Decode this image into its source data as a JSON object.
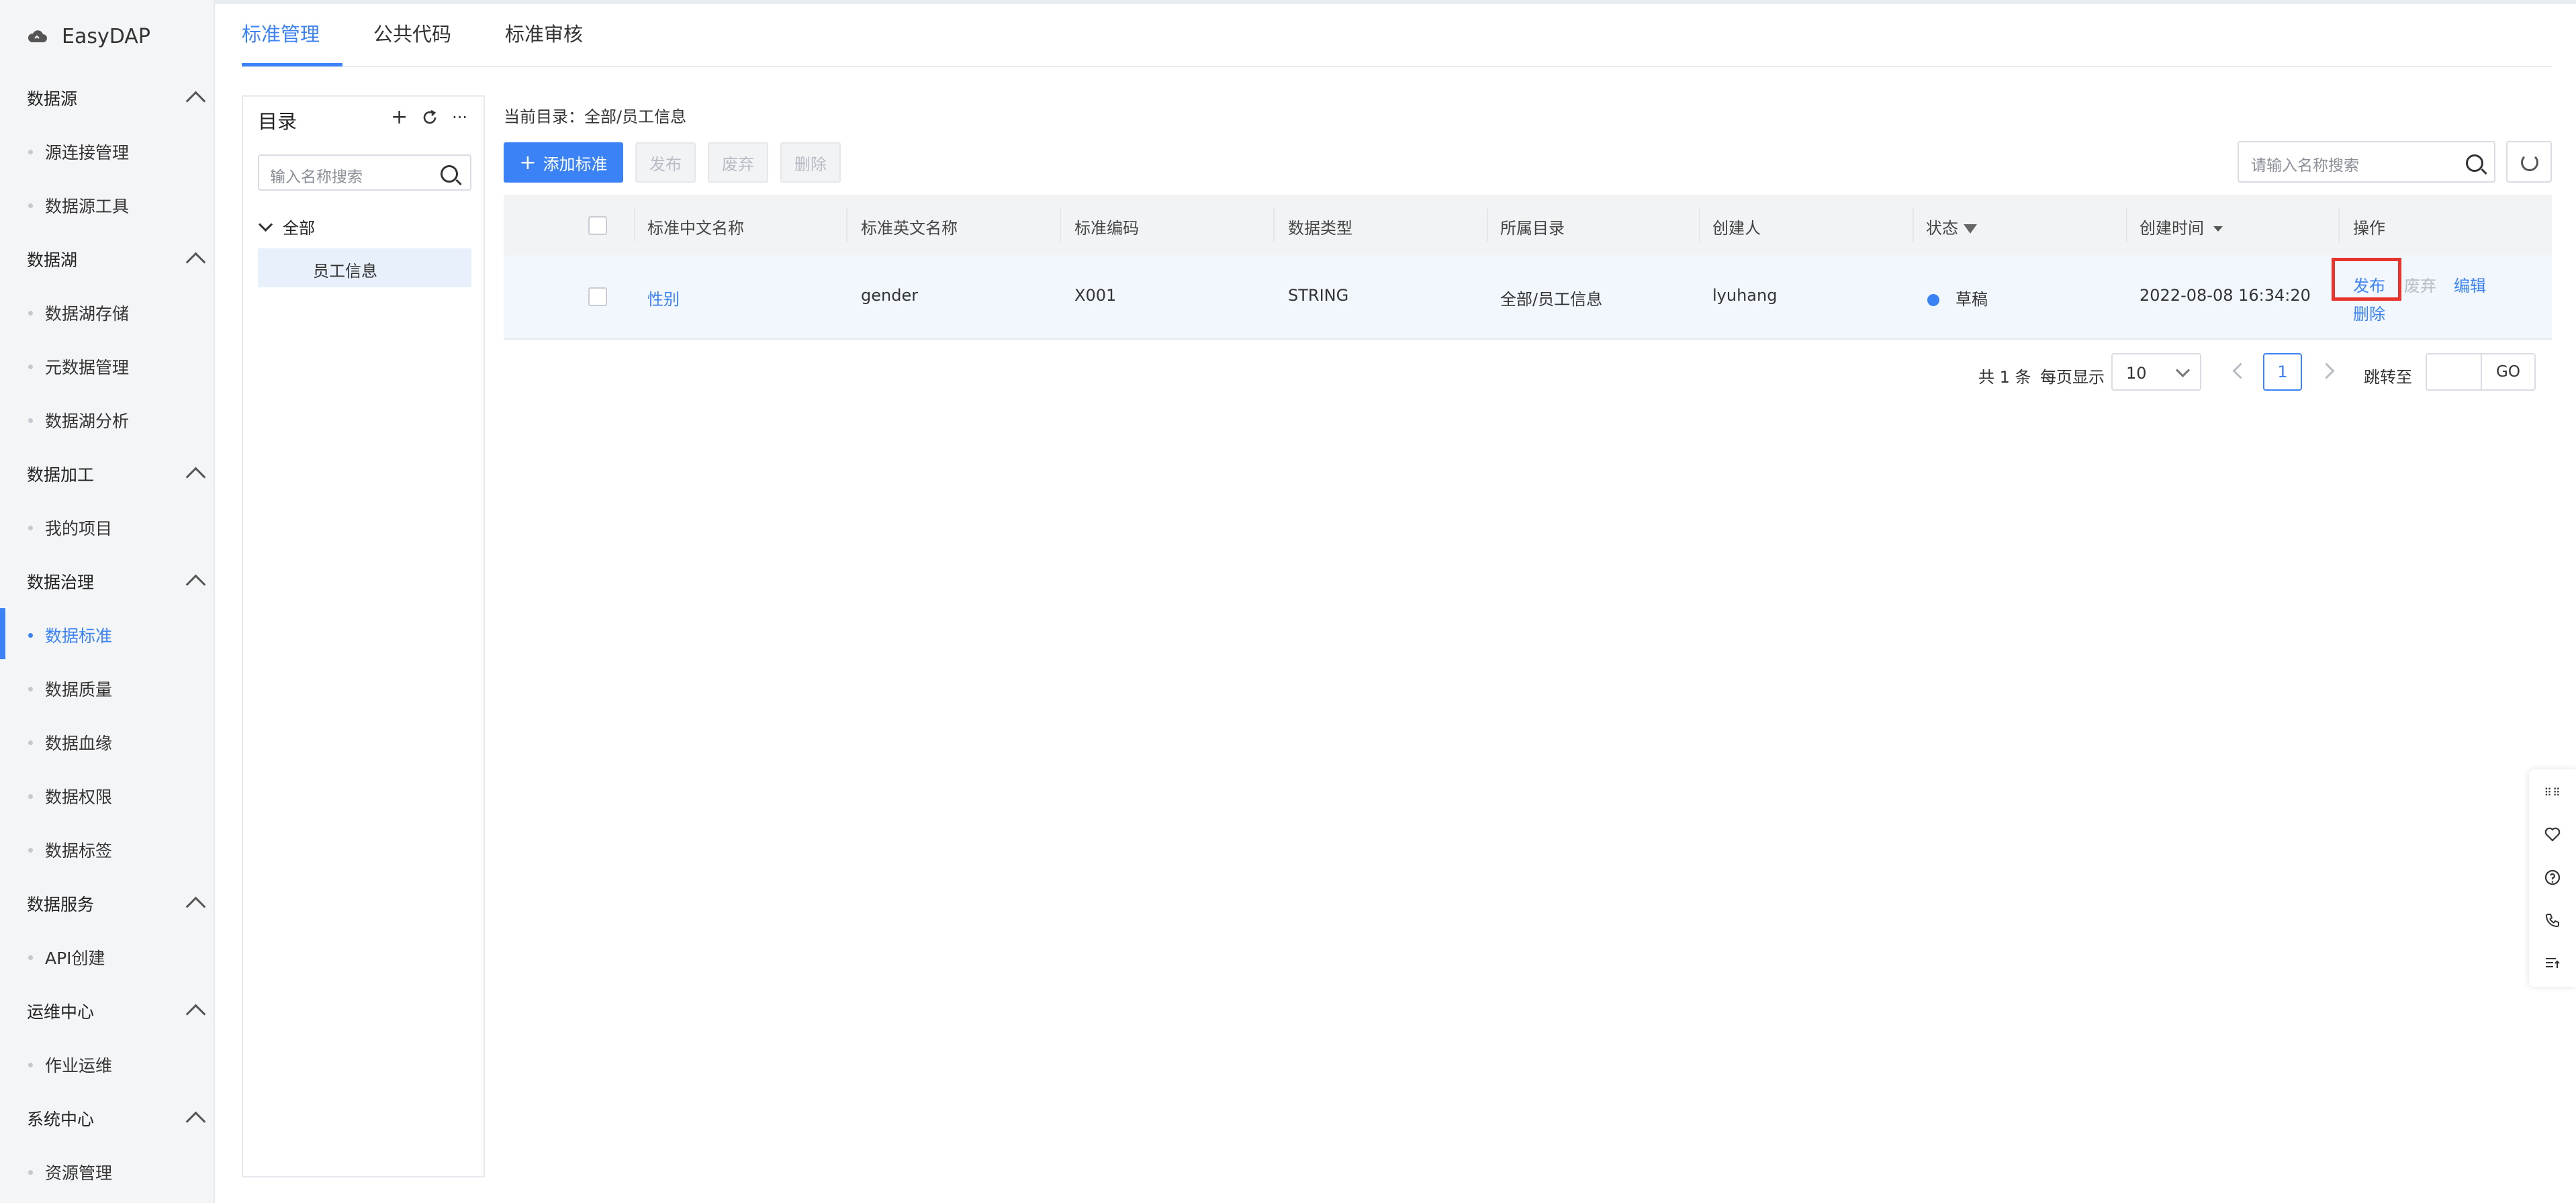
{
  "app": {
    "name": "EasyDAP"
  },
  "sidebar": {
    "groups": [
      {
        "label": "数据源",
        "items": [
          "源连接管理",
          "数据源工具"
        ]
      },
      {
        "label": "数据湖",
        "items": [
          "数据湖存储",
          "元数据管理",
          "数据湖分析"
        ]
      },
      {
        "label": "数据加工",
        "items": [
          "我的项目"
        ]
      },
      {
        "label": "数据治理",
        "items": [
          "数据标准",
          "数据质量",
          "数据血缘",
          "数据权限",
          "数据标签"
        ]
      },
      {
        "label": "数据服务",
        "items": [
          "API创建"
        ]
      },
      {
        "label": "运维中心",
        "items": [
          "作业运维"
        ]
      },
      {
        "label": "系统中心",
        "items": [
          "资源管理"
        ]
      }
    ],
    "active_item": "数据标准"
  },
  "tabs": {
    "items": [
      "标准管理",
      "公共代码",
      "标准审核"
    ],
    "active": "标准管理"
  },
  "catalog": {
    "title": "目录",
    "search_placeholder": "输入名称搜索",
    "tree_root": "全部",
    "tree_child": "员工信息",
    "tools": {
      "add": "+",
      "more": "···"
    }
  },
  "main": {
    "current_dir_label": "当前目录：全部/员工信息",
    "buttons": {
      "add": "添加标准",
      "publish": "发布",
      "discard": "废弃",
      "delete": "删除"
    },
    "search_placeholder": "请输入名称搜索"
  },
  "table": {
    "columns": [
      "标准中文名称",
      "标准英文名称",
      "标准编码",
      "数据类型",
      "所属目录",
      "创建人",
      "状态",
      "创建时间",
      "操作"
    ],
    "rows": [
      {
        "cn_name": "性别",
        "en_name": "gender",
        "code": "X001",
        "type": "STRING",
        "dir": "全部/员工信息",
        "creator": "lyuhang",
        "status": "草稿",
        "created": "2022-08-08 16:34:20",
        "actions": {
          "publish": "发布",
          "discard": "废弃",
          "edit": "编辑",
          "delete": "删除"
        }
      }
    ]
  },
  "pagination": {
    "total": "共 1 条",
    "page_size_label": "每页显示",
    "page_size": "10",
    "current_page": "1",
    "jump_label": "跳转至",
    "go": "GO"
  },
  "colors": {
    "accent": "#3b82f6",
    "highlight": "#e8342c",
    "sidebar_bg": "#f4f5f7"
  },
  "icons": [
    "cloud-icon",
    "chevron-up-icon",
    "plus-icon",
    "refresh-icon",
    "more-icon",
    "search-icon",
    "filter-icon",
    "sort-caret-icon",
    "drag-grid-icon",
    "heart-chat-icon",
    "help-icon",
    "phone-icon",
    "list-icon"
  ]
}
